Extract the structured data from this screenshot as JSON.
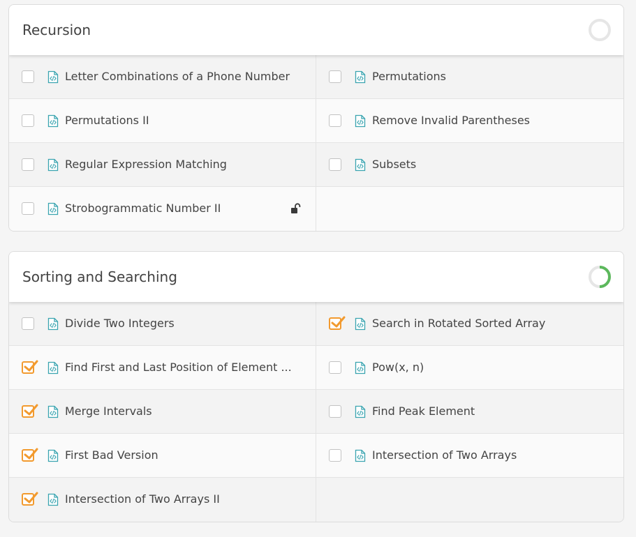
{
  "sections": [
    {
      "title": "Recursion",
      "progress": 0,
      "rows": [
        [
          {
            "label": "Letter Combinations of a Phone Number",
            "checked": false
          },
          {
            "label": "Permutations",
            "checked": false
          }
        ],
        [
          {
            "label": "Permutations II",
            "checked": false
          },
          {
            "label": "Remove Invalid Parentheses",
            "checked": false
          }
        ],
        [
          {
            "label": "Regular Expression Matching",
            "checked": false
          },
          {
            "label": "Subsets",
            "checked": false
          }
        ],
        [
          {
            "label": "Strobogrammatic Number II",
            "checked": false,
            "locked": true
          },
          null
        ]
      ]
    },
    {
      "title": "Sorting and Searching",
      "progress": 0.5,
      "rows": [
        [
          {
            "label": "Divide Two Integers",
            "checked": false
          },
          {
            "label": "Search in Rotated Sorted Array",
            "checked": true
          }
        ],
        [
          {
            "label": "Find First and Last Position of Element ...",
            "checked": true
          },
          {
            "label": "Pow(x, n)",
            "checked": false
          }
        ],
        [
          {
            "label": "Merge Intervals",
            "checked": true
          },
          {
            "label": "Find Peak Element",
            "checked": false
          }
        ],
        [
          {
            "label": "First Bad Version",
            "checked": true
          },
          {
            "label": "Intersection of Two Arrays",
            "checked": false
          }
        ],
        [
          {
            "label": "Intersection of Two Arrays II",
            "checked": true
          },
          null
        ]
      ]
    }
  ],
  "colors": {
    "check": "#f29a2e",
    "progress": "#5cb85c",
    "progress_track": "#e6e6e6",
    "file_icon": "#3aa4b0"
  },
  "icons": {
    "file": "code-file-icon",
    "lock": "unlocked-padlock-icon",
    "check": "checkmark-icon"
  }
}
